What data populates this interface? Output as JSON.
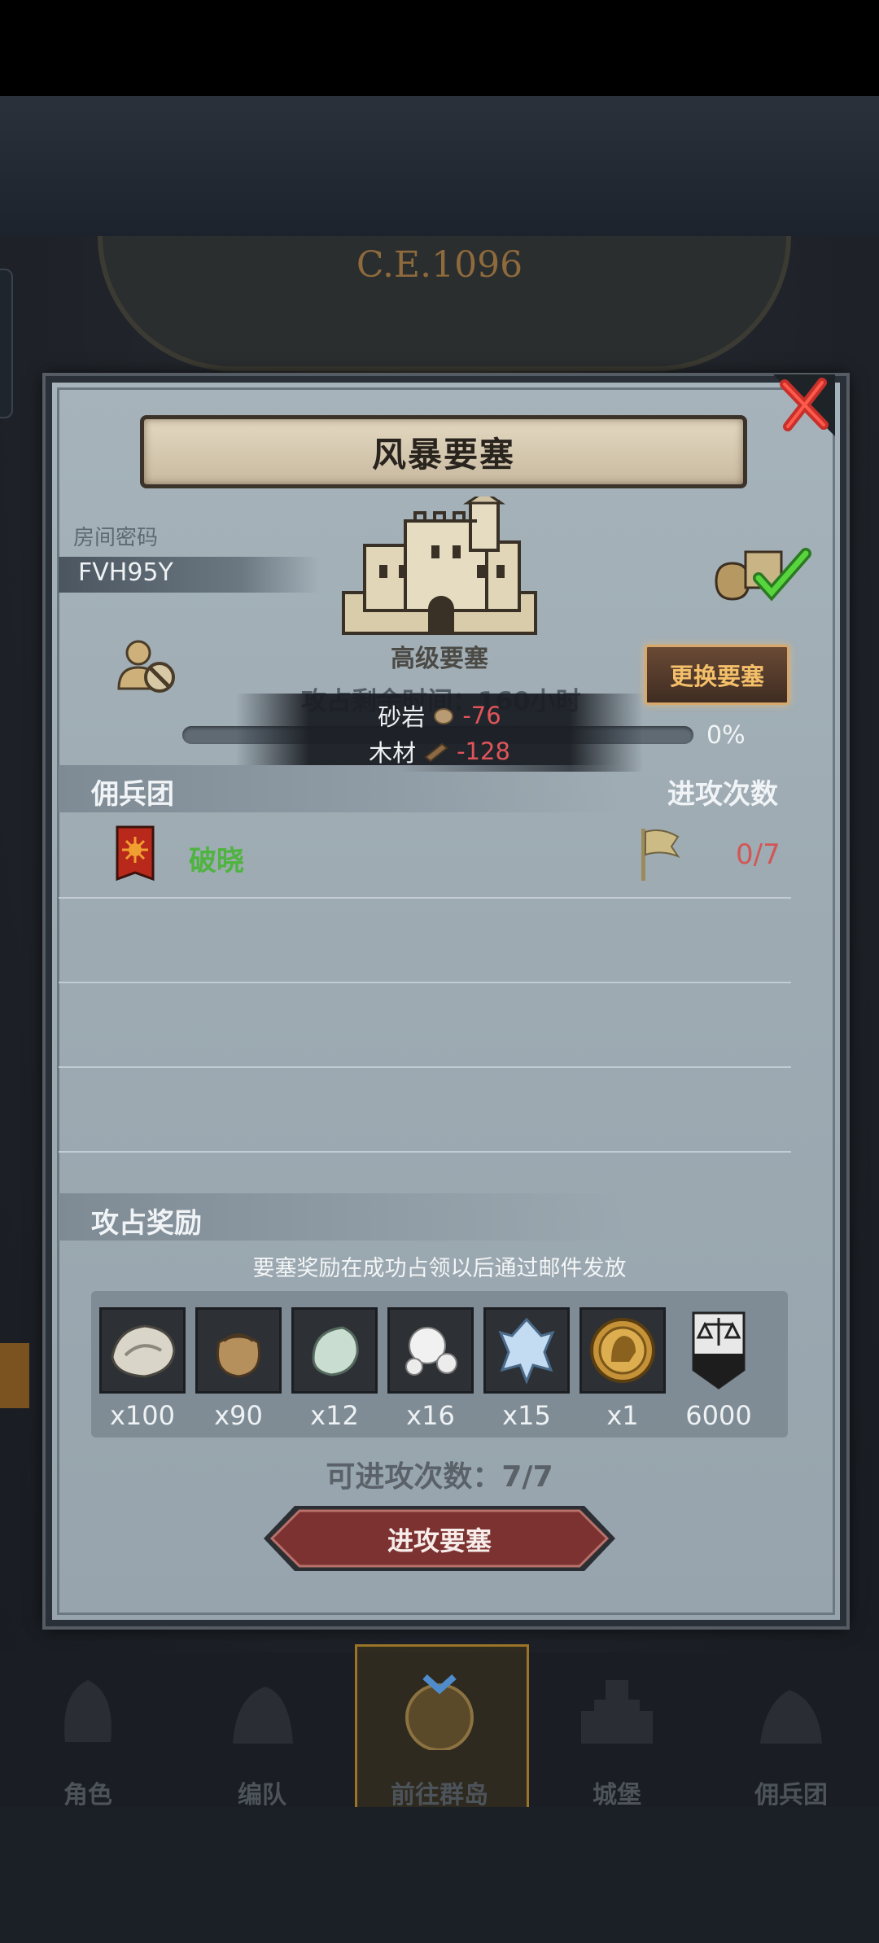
{
  "background": {
    "era_text": "C.E.1096"
  },
  "dialog": {
    "title": "风暴要塞",
    "room_code_label": "房间密码",
    "room_code": "FVH95Y",
    "fortress_level": "高级要塞",
    "change_button": "更换要塞",
    "occupy_time": "攻占剩余时间：160小时",
    "progress_fraction": 0,
    "progress_text": "0%",
    "cost_tooltip": [
      {
        "name": "砂岩",
        "value": "-76"
      },
      {
        "name": "木材",
        "value": "-128"
      }
    ],
    "mercenary_header": "佣兵团",
    "attack_count_header": "进攻次数",
    "mercenary_rows": [
      {
        "name": "破晓",
        "count": "0/7"
      }
    ],
    "reward_header": "攻占奖励",
    "reward_note": "要塞奖励在成功占领以后通过邮件发放",
    "rewards": [
      {
        "icon": "oyster-icon",
        "qty": "x100"
      },
      {
        "icon": "sack-icon",
        "qty": "x90"
      },
      {
        "icon": "moonstone-icon",
        "qty": "x12"
      },
      {
        "icon": "pearl-icon",
        "qty": "x16"
      },
      {
        "icon": "crystal-icon",
        "qty": "x15"
      },
      {
        "icon": "knight-medal-icon",
        "qty": "x1"
      },
      {
        "icon": "justice-banner-icon",
        "qty": "6000"
      }
    ],
    "attack_times": "可进攻次数：7/7",
    "attack_button": "进攻要塞"
  },
  "nav": {
    "items": [
      {
        "label": "角色"
      },
      {
        "label": "编队"
      },
      {
        "label": "前往群岛"
      },
      {
        "label": "城堡"
      },
      {
        "label": "佣兵团"
      }
    ],
    "active_index": 2
  },
  "colors": {
    "accent_gold": "#f3bf69",
    "merc_name_green": "#4fb43f",
    "negative_red": "#e0555a"
  }
}
